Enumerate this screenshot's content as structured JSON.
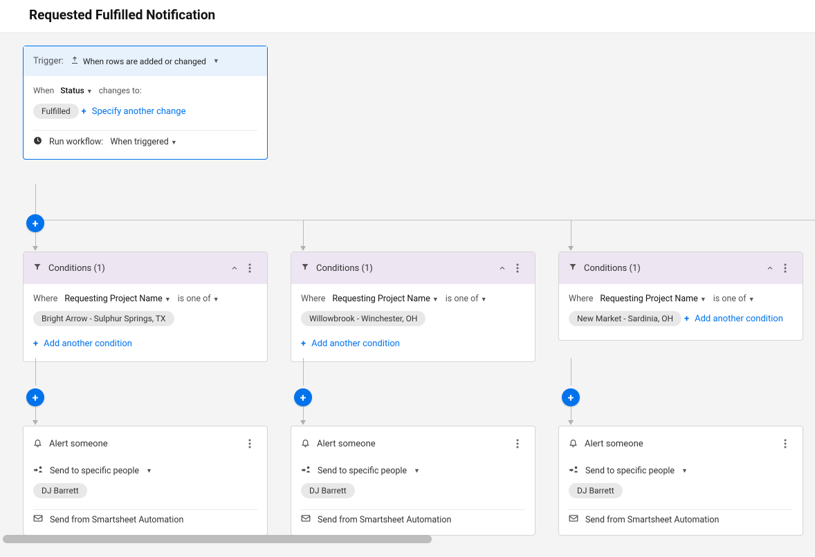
{
  "title": "Requested Fulfilled Notification",
  "trigger": {
    "label": "Trigger:",
    "type_label": "When rows are added or changed",
    "when_label": "When",
    "field": "Status",
    "changes_label": "changes to:",
    "value": "Fulfilled",
    "specify_another": "Specify another change",
    "run_label": "Run workflow:",
    "run_value": "When triggered"
  },
  "shared": {
    "conditions_title": "Conditions (1)",
    "where_label": "Where",
    "cond_field": "Requesting Project Name",
    "cond_op": "is one of",
    "add_condition": "Add another condition",
    "alert_title": "Alert someone",
    "send_label": "Send to specific people",
    "send_from": "Send from Smartsheet Automation"
  },
  "branches": [
    {
      "value": "Bright Arrow - Sulphur Springs, TX",
      "recipient": "DJ Barrett"
    },
    {
      "value": "Willowbrook - Winchester, OH",
      "recipient": "DJ Barrett"
    },
    {
      "value": "New Market - Sardinia, OH",
      "recipient": "DJ Barrett"
    }
  ]
}
